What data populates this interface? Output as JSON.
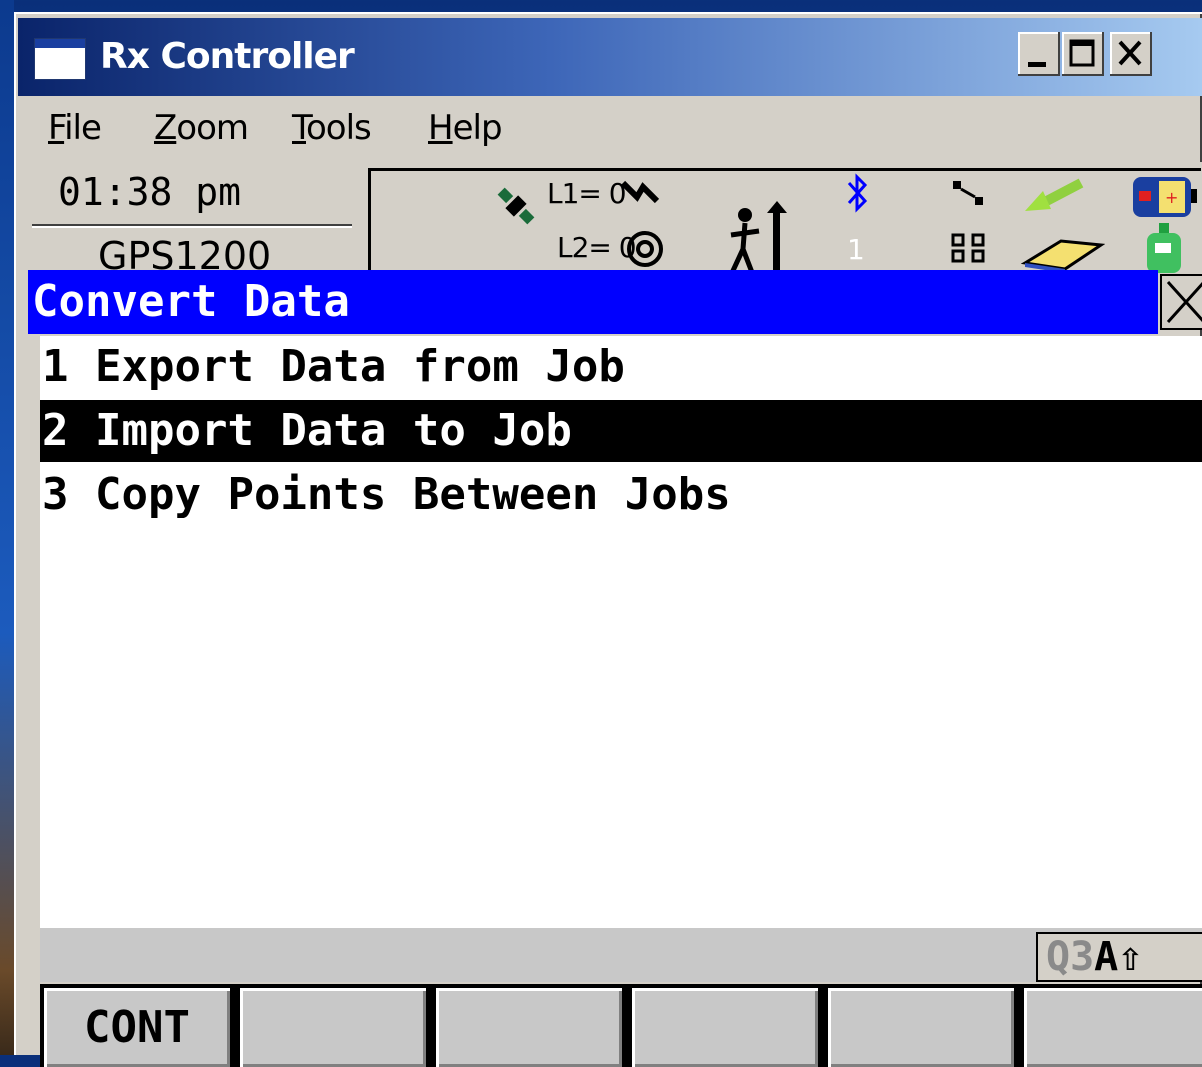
{
  "window": {
    "title": "Rx Controller",
    "controls": {
      "minimize": "minimize",
      "maximize": "maximize",
      "close": "close"
    }
  },
  "menu": {
    "file": {
      "first": "F",
      "rest": "ile"
    },
    "zoom": {
      "first": "Z",
      "rest": "oom"
    },
    "tools": {
      "first": "T",
      "rest": "ools"
    },
    "help": {
      "first": "H",
      "rest": "elp"
    }
  },
  "status": {
    "time": "01:38 pm",
    "device": "GPS1200",
    "l1_label": "L1= 0",
    "l2_label": "L2= 0",
    "count": "1",
    "icons": [
      "satellite-icon",
      "signal-icon",
      "at-icon",
      "person-height-icon",
      "bluetooth-icon",
      "link-icon",
      "arrow-icon",
      "battery-icon",
      "network-icon",
      "memory-card-icon",
      "device-icon"
    ]
  },
  "screen": {
    "title": "Convert Data",
    "items": [
      {
        "number": "1",
        "label": "Export Data from Job"
      },
      {
        "number": "2",
        "label": "Import Data to Job"
      },
      {
        "number": "3",
        "label": "Copy Points Between Jobs"
      }
    ],
    "selected_index": 1
  },
  "mode": {
    "q": "Q3",
    "a": "A",
    "shift": "⇧"
  },
  "fkeys": [
    "CONT",
    "",
    "",
    "",
    "",
    ""
  ],
  "colors": {
    "title_bar": "#0000ff",
    "selection": "#000000",
    "background": "#ffffff",
    "window_chrome": "#d4d0c8"
  }
}
